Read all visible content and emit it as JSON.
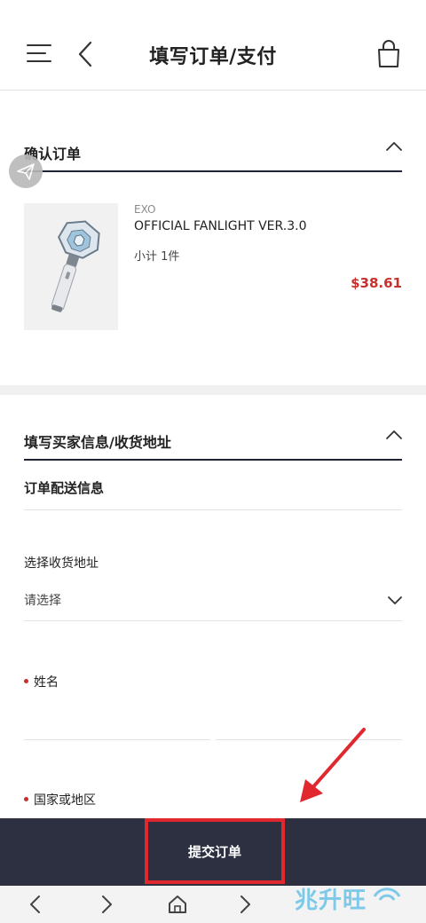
{
  "header": {
    "title": "填写订单/支付"
  },
  "order_section": {
    "title": "确认订单",
    "item": {
      "brand": "EXO",
      "name": "OFFICIAL FANLIGHT VER.3.0",
      "subtotal": "小计 1件",
      "price": "$38.61"
    }
  },
  "buyer_section": {
    "title": "填写买家信息/收货地址",
    "subtitle": "订单配送信息",
    "address_label": "选择收货地址",
    "address_value": "请选择",
    "name_label": "姓名",
    "country_label": "国家或地区"
  },
  "footer": {
    "submit_label": "提交订单"
  },
  "watermark": {
    "text": "兆升旺"
  },
  "colors": {
    "accent_red": "#c9302c",
    "dark_navy": "#2d3041",
    "highlight_red": "#e0282e"
  }
}
